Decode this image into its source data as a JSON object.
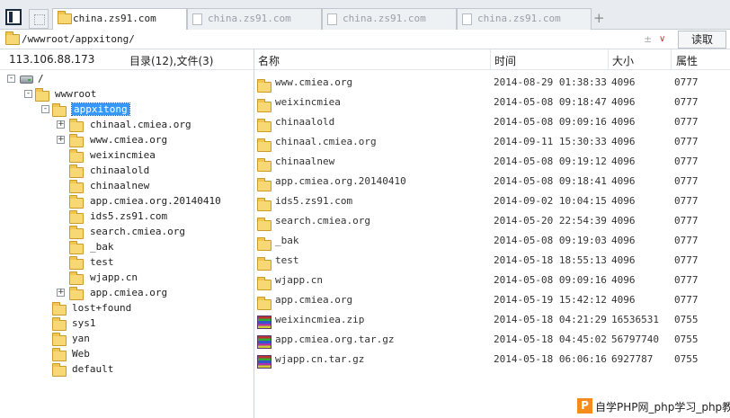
{
  "tabs": [
    {
      "label": "china.zs91.com",
      "active": true
    },
    {
      "label": "china.zs91.com",
      "active": false
    },
    {
      "label": "china.zs91.com",
      "active": false
    },
    {
      "label": "china.zs91.com",
      "active": false
    }
  ],
  "tab_add_label": "+",
  "address": {
    "path": "/wwwroot/appxitong/",
    "dropdown_glyph": "±",
    "chevron_glyph": "∨",
    "read_button": "读取"
  },
  "left": {
    "ip": "113.106.88.173",
    "counts": "目录(12),文件(3)",
    "tree": [
      {
        "label": "/",
        "expander": "-",
        "icon": "drive"
      },
      {
        "label": "wwwroot",
        "expander": "-",
        "icon": "folder"
      },
      {
        "label": "appxitong",
        "expander": "-",
        "icon": "folder",
        "selected": true
      },
      {
        "label": "chinaal.cmiea.org",
        "expander": "+",
        "icon": "folder"
      },
      {
        "label": "www.cmiea.org",
        "expander": "+",
        "icon": "folder"
      },
      {
        "label": "weixincmiea",
        "expander": "",
        "icon": "folder"
      },
      {
        "label": "chinaalold",
        "expander": "",
        "icon": "folder"
      },
      {
        "label": "chinaalnew",
        "expander": "",
        "icon": "folder"
      },
      {
        "label": "app.cmiea.org.20140410",
        "expander": "",
        "icon": "folder"
      },
      {
        "label": "ids5.zs91.com",
        "expander": "",
        "icon": "folder"
      },
      {
        "label": "search.cmiea.org",
        "expander": "",
        "icon": "folder"
      },
      {
        "label": "_bak",
        "expander": "",
        "icon": "folder"
      },
      {
        "label": "test",
        "expander": "",
        "icon": "folder"
      },
      {
        "label": "wjapp.cn",
        "expander": "",
        "icon": "folder"
      },
      {
        "label": "app.cmiea.org",
        "expander": "+",
        "icon": "folder"
      },
      {
        "label": "lost+found",
        "expander": "",
        "icon": "folder"
      },
      {
        "label": "sys1",
        "expander": "",
        "icon": "folder"
      },
      {
        "label": "yan",
        "expander": "",
        "icon": "folder"
      },
      {
        "label": "Web",
        "expander": "",
        "icon": "folder"
      },
      {
        "label": "default",
        "expander": "",
        "icon": "folder"
      }
    ]
  },
  "columns": {
    "name": "名称",
    "time": "时间",
    "size": "大小",
    "attr": "属性"
  },
  "files": [
    {
      "name": "www.cmiea.org",
      "time": "2014-08-29 01:38:33",
      "size": "4096",
      "attr": "0777",
      "icon": "folder"
    },
    {
      "name": "weixincmiea",
      "time": "2014-05-08 09:18:47",
      "size": "4096",
      "attr": "0777",
      "icon": "folder"
    },
    {
      "name": "chinaalold",
      "time": "2014-05-08 09:09:16",
      "size": "4096",
      "attr": "0777",
      "icon": "folder"
    },
    {
      "name": "chinaal.cmiea.org",
      "time": "2014-09-11 15:30:33",
      "size": "4096",
      "attr": "0777",
      "icon": "folder"
    },
    {
      "name": "chinaalnew",
      "time": "2014-05-08 09:19:12",
      "size": "4096",
      "attr": "0777",
      "icon": "folder"
    },
    {
      "name": "app.cmiea.org.20140410",
      "time": "2014-05-08 09:18:41",
      "size": "4096",
      "attr": "0777",
      "icon": "folder"
    },
    {
      "name": "ids5.zs91.com",
      "time": "2014-09-02 10:04:15",
      "size": "4096",
      "attr": "0777",
      "icon": "folder"
    },
    {
      "name": "search.cmiea.org",
      "time": "2014-05-20 22:54:39",
      "size": "4096",
      "attr": "0777",
      "icon": "folder"
    },
    {
      "name": "_bak",
      "time": "2014-05-08 09:19:03",
      "size": "4096",
      "attr": "0777",
      "icon": "folder"
    },
    {
      "name": "test",
      "time": "2014-05-18 18:55:13",
      "size": "4096",
      "attr": "0777",
      "icon": "folder"
    },
    {
      "name": "wjapp.cn",
      "time": "2014-05-08 09:09:16",
      "size": "4096",
      "attr": "0777",
      "icon": "folder"
    },
    {
      "name": "app.cmiea.org",
      "time": "2014-05-19 15:42:12",
      "size": "4096",
      "attr": "0777",
      "icon": "folder"
    },
    {
      "name": "weixincmiea.zip",
      "time": "2014-05-18 04:21:29",
      "size": "16536531",
      "attr": "0755",
      "icon": "archive"
    },
    {
      "name": "app.cmiea.org.tar.gz",
      "time": "2014-05-18 04:45:02",
      "size": "56797740",
      "attr": "0755",
      "icon": "archive"
    },
    {
      "name": "wjapp.cn.tar.gz",
      "time": "2014-05-18 06:06:16",
      "size": "6927787",
      "attr": "0755",
      "icon": "archive"
    }
  ],
  "watermark": {
    "logo": "P",
    "text": "自学PHP网_php学习_php教"
  },
  "colors": {
    "selection": "#3399ff",
    "folder": "#f8d775",
    "watermark_logo": "#f68b1f"
  }
}
